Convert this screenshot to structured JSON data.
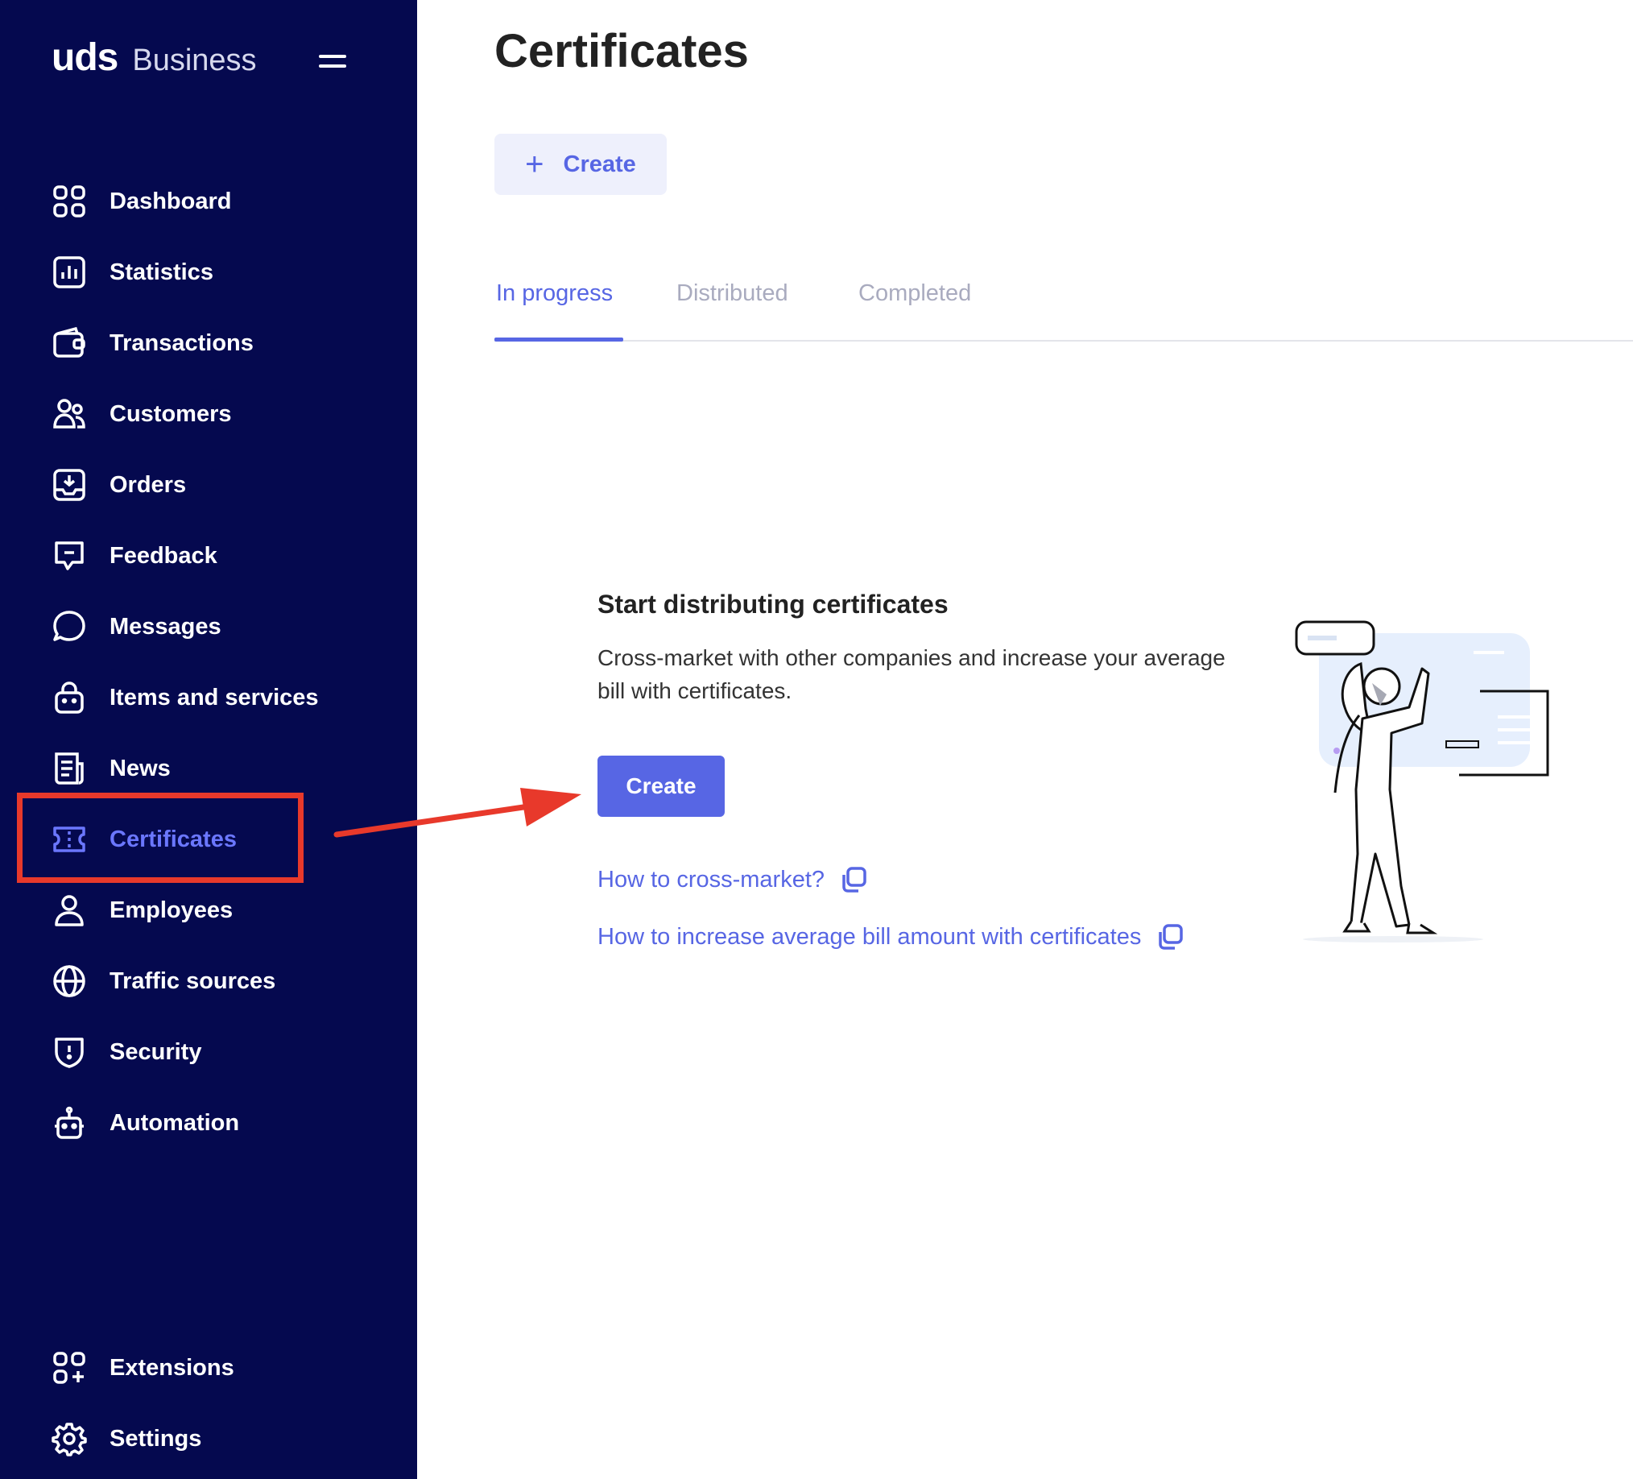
{
  "brand": {
    "name": "uds",
    "sub": "Business"
  },
  "sidebar": {
    "items": [
      {
        "label": "Dashboard",
        "icon": "dashboard-icon"
      },
      {
        "label": "Statistics",
        "icon": "statistics-icon"
      },
      {
        "label": "Transactions",
        "icon": "wallet-icon"
      },
      {
        "label": "Customers",
        "icon": "customers-icon"
      },
      {
        "label": "Orders",
        "icon": "inbox-icon"
      },
      {
        "label": "Feedback",
        "icon": "feedback-icon"
      },
      {
        "label": "Messages",
        "icon": "chat-icon"
      },
      {
        "label": "Items and services",
        "icon": "shopping-bag-icon"
      },
      {
        "label": "News",
        "icon": "newspaper-icon"
      },
      {
        "label": "Certificates",
        "icon": "ticket-icon",
        "active": true
      },
      {
        "label": "Employees",
        "icon": "user-icon"
      },
      {
        "label": "Traffic sources",
        "icon": "globe-icon"
      },
      {
        "label": "Security",
        "icon": "shield-icon"
      },
      {
        "label": "Automation",
        "icon": "robot-icon"
      }
    ],
    "bottom_items": [
      {
        "label": "Extensions",
        "icon": "extensions-icon"
      },
      {
        "label": "Settings",
        "icon": "gear-icon"
      }
    ]
  },
  "main": {
    "title": "Certificates",
    "create_button": "Create",
    "tabs": [
      "In progress",
      "Distributed",
      "Completed"
    ],
    "empty_state": {
      "title": "Start distributing certificates",
      "description": "Cross-market with other companies and increase your average bill with certificates.",
      "create_button": "Create",
      "links": [
        "How to cross-market?",
        "How to increase average bill amount with certificates"
      ]
    }
  },
  "colors": {
    "sidebar_bg": "#05094f",
    "accent": "#5766e4",
    "active_nav": "#6b77ff",
    "annotation_red": "#e8392b"
  }
}
